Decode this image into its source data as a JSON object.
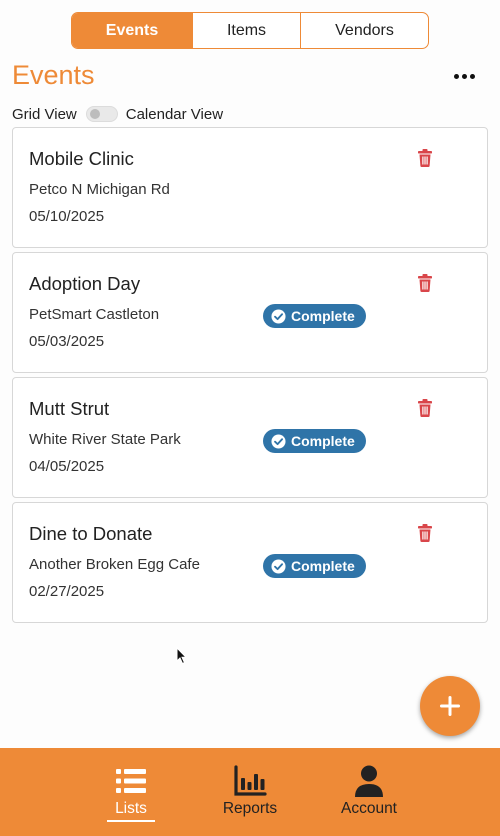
{
  "segments": [
    {
      "label": "Events",
      "active": true
    },
    {
      "label": "Items",
      "active": false
    },
    {
      "label": "Vendors",
      "active": false
    }
  ],
  "page_title": "Events",
  "view_toggle": {
    "left_label": "Grid View",
    "right_label": "Calendar View",
    "on": false
  },
  "events": [
    {
      "title": "Mobile Clinic",
      "location": "Petco N Michigan Rd",
      "date": "05/10/2025",
      "status": ""
    },
    {
      "title": "Adoption Day",
      "location": "PetSmart Castleton",
      "date": "05/03/2025",
      "status": "Complete"
    },
    {
      "title": "Mutt Strut",
      "location": "White River State Park",
      "date": "04/05/2025",
      "status": "Complete"
    },
    {
      "title": "Dine to Donate",
      "location": "Another Broken Egg Cafe",
      "date": "02/27/2025",
      "status": "Complete"
    }
  ],
  "tabs": [
    {
      "label": "Lists",
      "icon": "list-icon",
      "active": true
    },
    {
      "label": "Reports",
      "icon": "bar-chart-icon",
      "active": false
    },
    {
      "label": "Account",
      "icon": "person-icon",
      "active": false
    }
  ],
  "colors": {
    "accent": "#ee8a37",
    "badge": "#2f74a8",
    "trash": "#d9464a"
  }
}
